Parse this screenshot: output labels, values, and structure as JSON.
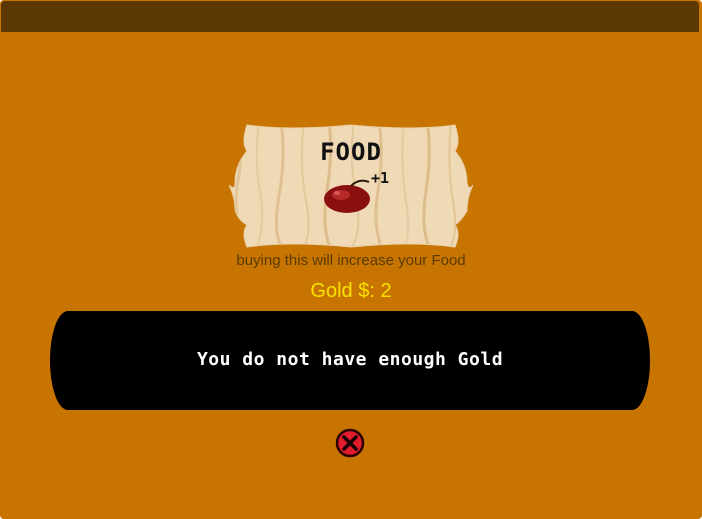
{
  "shop_item": {
    "title": "FOOD",
    "bonus": "+1",
    "icon": "apple-icon",
    "description": "buying this will increase your Food"
  },
  "gold": {
    "label": "Gold $: 2"
  },
  "message": {
    "text": "You do not have enough Gold"
  },
  "close": {
    "icon": "close-icon"
  },
  "colors": {
    "background": "#c87400",
    "top_bar": "#5a3800",
    "gold_text": "#f7e100",
    "message_bg": "#000000",
    "close_red": "#e21d2d"
  }
}
